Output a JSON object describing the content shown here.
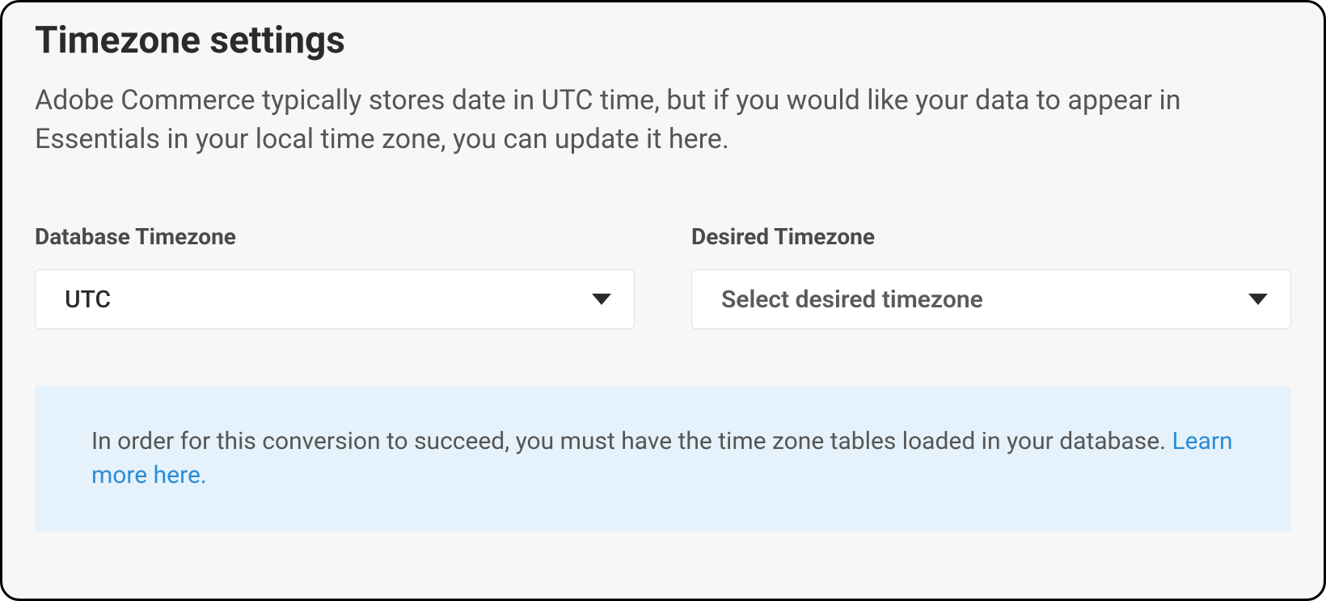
{
  "panel": {
    "title": "Timezone settings",
    "description": "Adobe Commerce typically stores date in UTC time, but if you would like your data to appear in Essentials in your local time zone, you can update it here."
  },
  "fields": {
    "database": {
      "label": "Database Timezone",
      "value": "UTC"
    },
    "desired": {
      "label": "Desired Timezone",
      "placeholder": "Select desired timezone"
    }
  },
  "notice": {
    "text": "In order for this conversion to succeed, you must have the time zone tables loaded in your database. ",
    "link_text": "Learn more here."
  }
}
